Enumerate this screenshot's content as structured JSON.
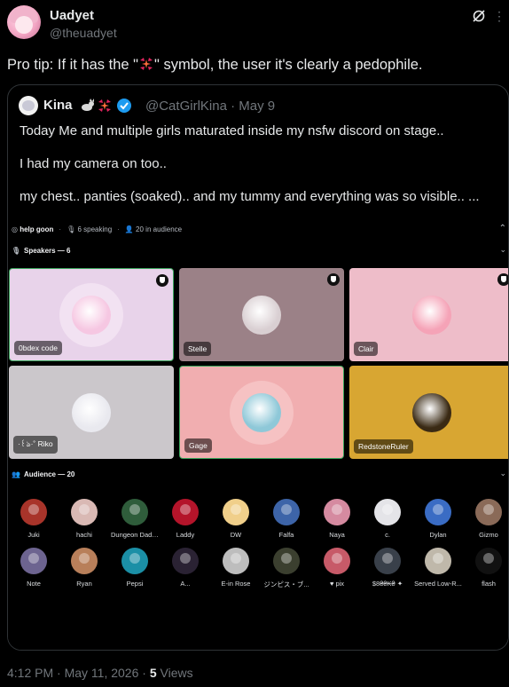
{
  "post": {
    "author_name": "Uadyet",
    "author_handle": "@theuadyet",
    "text_before": "Pro tip: If it has the \"",
    "text_after": "\" symbol, the user it's clearly a pedophile.",
    "emoji_icon": "anger-symbol-icon",
    "timestamp": "4:12 PM · May 11, 2026 · ",
    "views_count": "5",
    "views_label": " Views"
  },
  "quote": {
    "name": "Kina",
    "handle_date": "@CatGirlKina · May 9",
    "lines": [
      "Today Me and multiple girls maturated inside my nsfw discord on stage..",
      "I had my camera on too..",
      "my chest.. panties (soaked).. and my tummy and everything was so visible.. ..."
    ]
  },
  "stage": {
    "channel": "help goon",
    "speaking": "6 speaking",
    "in_audience": "20 in audience",
    "speakers_label": "Speakers — 6",
    "audience_label": "Audience — 20",
    "speakers": [
      {
        "name": "0bdex code",
        "bg": "#e8d3ea",
        "halo": "#f2e2f2",
        "pfp": "#f6c7e2",
        "border": "#3ba55c"
      },
      {
        "name": "Stelle",
        "bg": "#9b8187",
        "halo": "",
        "pfp": "#d9cfd2",
        "border": ""
      },
      {
        "name": "Clair",
        "bg": "#eebdc9",
        "halo": "",
        "pfp": "#f5a3b7",
        "border": ""
      },
      {
        "name": "·꒰ঌ·˚ Riko",
        "bg": "#cbc7cb",
        "halo": "",
        "pfp": "#e9e9ef",
        "border": ""
      },
      {
        "name": "Gage",
        "bg": "#f1aeb0",
        "halo": "#f6c2c3",
        "pfp": "#8ec8d8",
        "border": "#3ba55c"
      },
      {
        "name": "RedstoneRuler",
        "bg": "#d8a632",
        "halo": "",
        "pfp": "#3a2a14",
        "border": ""
      }
    ],
    "audience": [
      {
        "name": "Juki",
        "color": "#a8342a"
      },
      {
        "name": "hachi",
        "color": "#d9b9b4"
      },
      {
        "name": "Dungeon Daddy",
        "color": "#2f5d3b"
      },
      {
        "name": "Laddy",
        "color": "#b4142a"
      },
      {
        "name": "DW",
        "color": "#f0cf8a"
      },
      {
        "name": "Falfa",
        "color": "#3d64a8"
      },
      {
        "name": "Naya",
        "color": "#d58aa0"
      },
      {
        "name": "c.",
        "color": "#e4e4e8"
      },
      {
        "name": "Dylan",
        "color": "#3a6cc4"
      },
      {
        "name": "Gizmo",
        "color": "#8a6a58"
      },
      {
        "name": "Note",
        "color": "#6d6490"
      },
      {
        "name": "Ryan",
        "color": "#b87f5a"
      },
      {
        "name": "Pepsi",
        "color": "#1b8fa6"
      },
      {
        "name": "A...",
        "color": "#2a2233"
      },
      {
        "name": "E-in Rose",
        "color": "#bdbdbd"
      },
      {
        "name": "ジンピス・ブ...",
        "color": "#3b3f2f"
      },
      {
        "name": "♥ pix",
        "color": "#c75a68"
      },
      {
        "name": "$8₴₴₭₴ ✦",
        "color": "#39404a"
      },
      {
        "name": "Served Low-R...",
        "color": "#bfb8aa"
      },
      {
        "name": "flash",
        "color": "#111111"
      }
    ]
  }
}
